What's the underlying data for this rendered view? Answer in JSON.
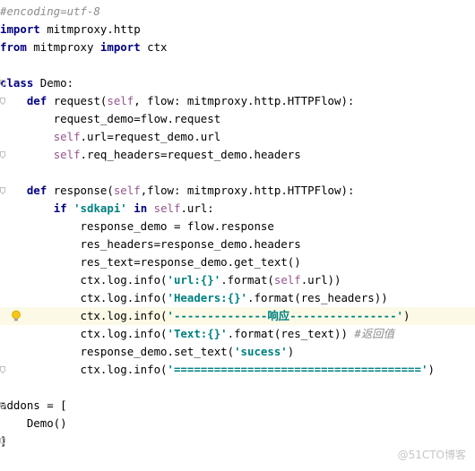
{
  "editor": {
    "language": "python",
    "lines": [
      [
        {
          "t": "#encoding=utf-8",
          "c": "comment"
        }
      ],
      [
        {
          "t": "import",
          "c": "kw"
        },
        {
          "t": " mitmproxy.http",
          "c": "plain"
        }
      ],
      [
        {
          "t": "from",
          "c": "kw"
        },
        {
          "t": " mitmproxy ",
          "c": "plain"
        },
        {
          "t": "import",
          "c": "kw"
        },
        {
          "t": " ctx",
          "c": "plain"
        }
      ],
      [],
      [
        {
          "t": "class",
          "c": "kw"
        },
        {
          "t": " Demo:",
          "c": "plain"
        }
      ],
      [
        {
          "t": "    ",
          "c": "plain"
        },
        {
          "t": "def",
          "c": "kw"
        },
        {
          "t": " request(",
          "c": "plain"
        },
        {
          "t": "self",
          "c": "self"
        },
        {
          "t": ", flow: mitmproxy.http.HTTPFlow):",
          "c": "plain"
        }
      ],
      [
        {
          "t": "        request_demo=flow.request",
          "c": "plain"
        }
      ],
      [
        {
          "t": "        ",
          "c": "plain"
        },
        {
          "t": "self",
          "c": "self"
        },
        {
          "t": ".url=request_demo.url",
          "c": "plain"
        }
      ],
      [
        {
          "t": "        ",
          "c": "plain"
        },
        {
          "t": "self",
          "c": "self"
        },
        {
          "t": ".req_headers=request_demo.headers",
          "c": "plain"
        }
      ],
      [],
      [
        {
          "t": "    ",
          "c": "plain"
        },
        {
          "t": "def",
          "c": "kw"
        },
        {
          "t": " response(",
          "c": "plain"
        },
        {
          "t": "self",
          "c": "self"
        },
        {
          "t": ",flow: mitmproxy.http.HTTPFlow):",
          "c": "plain"
        }
      ],
      [
        {
          "t": "        ",
          "c": "plain"
        },
        {
          "t": "if",
          "c": "kw"
        },
        {
          "t": " ",
          "c": "plain"
        },
        {
          "t": "'sdkapi'",
          "c": "str"
        },
        {
          "t": " ",
          "c": "plain"
        },
        {
          "t": "in",
          "c": "kw"
        },
        {
          "t": " ",
          "c": "plain"
        },
        {
          "t": "self",
          "c": "self"
        },
        {
          "t": ".url:",
          "c": "plain"
        }
      ],
      [
        {
          "t": "            response_demo = flow.response",
          "c": "plain"
        }
      ],
      [
        {
          "t": "            res_headers=response_demo.headers",
          "c": "plain"
        }
      ],
      [
        {
          "t": "            res_text=response_demo.get_text()",
          "c": "plain"
        }
      ],
      [
        {
          "t": "            ctx.log.info(",
          "c": "plain"
        },
        {
          "t": "'url:{}'",
          "c": "str"
        },
        {
          "t": ".format(",
          "c": "plain"
        },
        {
          "t": "self",
          "c": "self"
        },
        {
          "t": ".url))",
          "c": "plain"
        }
      ],
      [
        {
          "t": "            ctx.log.info(",
          "c": "plain"
        },
        {
          "t": "'Headers:{}'",
          "c": "str"
        },
        {
          "t": ".format(res_headers))",
          "c": "plain"
        }
      ],
      [
        {
          "t": "            ctx.log.info(",
          "c": "plain"
        },
        {
          "t": "'--------------响应----------------'",
          "c": "str"
        },
        {
          "t": ")",
          "c": "plain"
        }
      ],
      [
        {
          "t": "            ctx.log.info(",
          "c": "plain"
        },
        {
          "t": "'Text:{}'",
          "c": "str"
        },
        {
          "t": ".format(res_text)) ",
          "c": "plain"
        },
        {
          "t": "#返回值",
          "c": "comment"
        }
      ],
      [
        {
          "t": "            response_demo.set_text(",
          "c": "plain"
        },
        {
          "t": "'sucess'",
          "c": "str"
        },
        {
          "t": ")",
          "c": "plain"
        }
      ],
      [
        {
          "t": "            ctx.log.info(",
          "c": "plain"
        },
        {
          "t": "'====================================='",
          "c": "str"
        },
        {
          "t": ")",
          "c": "plain"
        }
      ],
      [],
      [
        {
          "t": "addons = [",
          "c": "plain"
        }
      ],
      [
        {
          "t": "    Demo()",
          "c": "plain"
        }
      ],
      [
        {
          "t": "]",
          "c": "plain"
        }
      ]
    ],
    "highlighted_line": 17,
    "intention_bulb_line": 17,
    "fold_markers": [
      4,
      5,
      8,
      10,
      20,
      22,
      24
    ]
  },
  "watermark": {
    "text": "@51CTO博客"
  },
  "colors": {
    "keyword": "#000080",
    "self": "#94558d",
    "string": "#008080",
    "comment": "#8c8c8c",
    "current_line": "#fcfae6"
  },
  "icons": {
    "intention": "lightbulb-icon",
    "fold": "fold-marker-icon"
  }
}
